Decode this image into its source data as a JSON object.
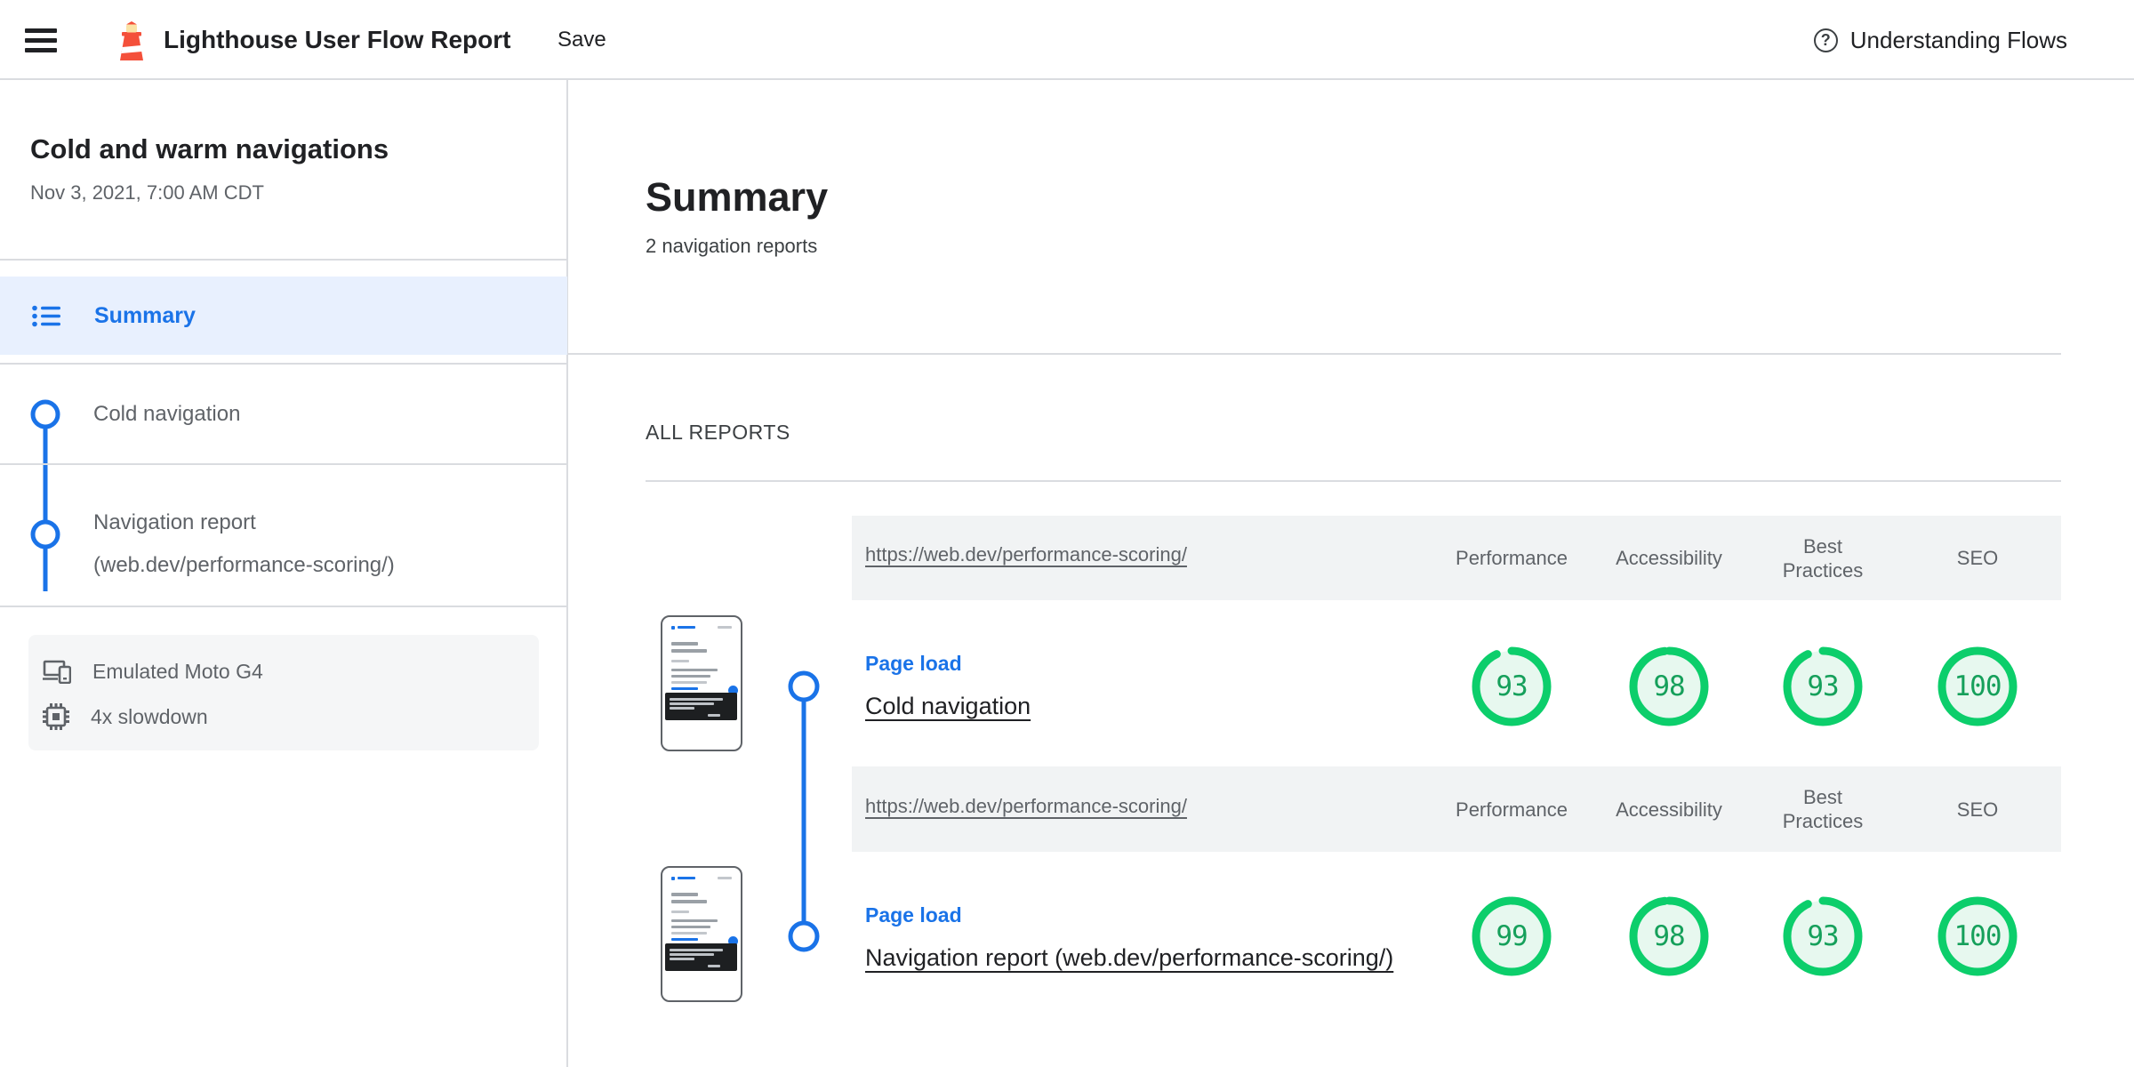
{
  "topbar": {
    "title": "Lighthouse User Flow Report",
    "save_label": "Save",
    "help_label": "Understanding Flows"
  },
  "sidebar": {
    "flow_name": "Cold and warm navigations",
    "timestamp": "Nov 3, 2021, 7:00 AM CDT",
    "summary_label": "Summary",
    "steps": [
      {
        "label": "Cold navigation",
        "lines": [
          "Cold navigation"
        ]
      },
      {
        "label": "Navigation report (web.dev/performance-scoring/)",
        "lines": [
          "Navigation report",
          "(web.dev/performance-scoring/)"
        ]
      }
    ],
    "device": {
      "name": "Emulated Moto G4",
      "throttling": "4x slowdown"
    }
  },
  "main": {
    "heading": "Summary",
    "subheading": "2 navigation reports",
    "section_label": "ALL REPORTS",
    "columns": [
      "Performance",
      "Accessibility",
      "Best Practices",
      "SEO"
    ],
    "reports": [
      {
        "url": "https://web.dev/performance-scoring/",
        "step_type": "Page load",
        "name": "Cold navigation",
        "scores": [
          93,
          98,
          93,
          100
        ]
      },
      {
        "url": "https://web.dev/performance-scoring/",
        "step_type": "Page load",
        "name": "Navigation report (web.dev/performance-scoring/)",
        "scores": [
          99,
          98,
          93,
          100
        ]
      }
    ]
  },
  "icons": {
    "menu": "hamburger-icon",
    "logo": "lighthouse-icon",
    "help": "question-circle-icon",
    "summary": "list-icon",
    "step": "timeline-circle-icon",
    "device": "devices-icon",
    "throttling": "memory-chip-icon"
  },
  "colors": {
    "accent_blue": "#1a73e8",
    "selected_bg": "#e8f0fe",
    "pass_green": "#0cce6b",
    "pass_green_fill": "#e7f8ef",
    "score_text": "#16a05b",
    "header_bg": "#f1f3f4",
    "divider": "#dadce0",
    "text_dark": "#202124",
    "text_grey": "#5f6368",
    "logo_orange": "#f4503a"
  }
}
